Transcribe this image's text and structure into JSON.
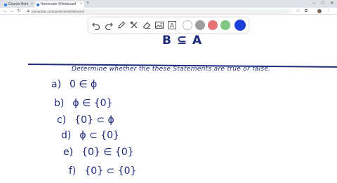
{
  "browser": {
    "tabs": [
      {
        "label": "Course Hero",
        "active": false
      },
      {
        "label": "Numerade Whiteboard",
        "active": true
      }
    ],
    "new_tab": "+",
    "controls": {
      "minimize": "–",
      "maximize": "□",
      "close": "✕"
    },
    "url": "numerade.com/questions/whiteboard/"
  },
  "toolbar": {
    "tools": [
      "undo-icon",
      "redo-icon",
      "pen-icon",
      "tools-icon",
      "eraser-icon",
      "image-icon",
      "text-icon"
    ],
    "text_tool_glyph": "A",
    "colors": [
      "#ffffff",
      "#9e9e9e",
      "#e57373",
      "#81c784",
      "#1a3fd9"
    ]
  },
  "board": {
    "heading": "B ⊆ A",
    "instruction": "Determine whether the these Statements are true or false.",
    "items": [
      {
        "label": "a)",
        "expr": "0 ∈ ϕ"
      },
      {
        "label": "b)",
        "expr": "ϕ ∈ {0}"
      },
      {
        "label": "c)",
        "expr": "{0} ⊂ ϕ"
      },
      {
        "label": "d)",
        "expr": "ϕ ⊂ {0}"
      },
      {
        "label": "e)",
        "expr": "{0} ∈ {0}"
      },
      {
        "label": "f)",
        "expr": "{0} ⊂ {0}"
      }
    ]
  }
}
